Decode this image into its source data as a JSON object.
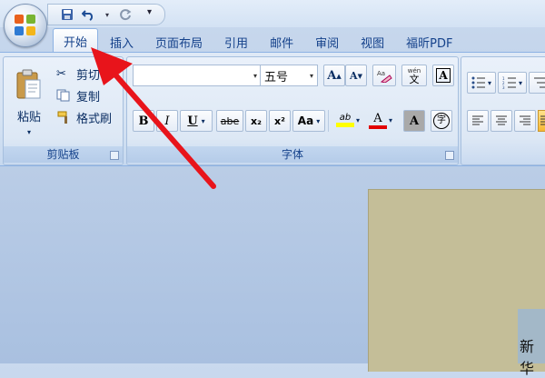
{
  "quick_access": {
    "dropdown_glyph": "▾",
    "icons": [
      "save-icon",
      "undo-icon",
      "redo-icon"
    ]
  },
  "tabs": [
    {
      "label": "开始",
      "active": true
    },
    {
      "label": "插入"
    },
    {
      "label": "页面布局"
    },
    {
      "label": "引用"
    },
    {
      "label": "邮件"
    },
    {
      "label": "审阅"
    },
    {
      "label": "视图"
    },
    {
      "label": "福昕PDF"
    }
  ],
  "clipboard": {
    "group_label": "剪贴板",
    "paste_label": "粘贴",
    "cut_label": "剪切",
    "copy_label": "复制",
    "format_painter_label": "格式刷"
  },
  "font": {
    "group_label": "字体",
    "font_name_value": "",
    "font_size_value": "五号",
    "grow_font": "A",
    "shrink_font": "A",
    "phonetic": "wén",
    "phonetic_char": "文",
    "border_char": "A",
    "bold": "B",
    "italic": "I",
    "underline": "U",
    "strikethrough": "abe",
    "subscript": "x₂",
    "superscript": "x²",
    "change_case": "Aa",
    "highlight": "ab",
    "font_color": "A",
    "shading": "A",
    "enclose": "字"
  },
  "document": {
    "visible_text": "新华"
  },
  "colors": {
    "accent": "#15428b",
    "arrow": "#e8141b",
    "highlight": "#ffff00",
    "font_color": "#e20000"
  }
}
